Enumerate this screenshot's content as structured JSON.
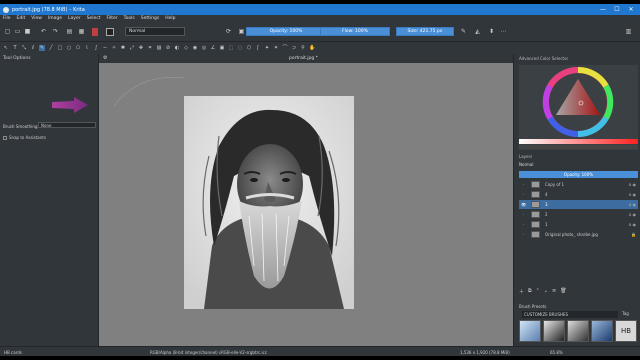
{
  "window": {
    "title": "portrait.jpg (78.8 MiB) – Krita",
    "controls": [
      "—",
      "☐",
      "✕"
    ]
  },
  "menu": [
    "File",
    "Edit",
    "View",
    "Image",
    "Layer",
    "Select",
    "Filter",
    "Tools",
    "Settings",
    "Help"
  ],
  "toolbar": {
    "blending_mode": "Normal",
    "opacity_label": "Opacity: 100%",
    "flow_label": "Flow: 100%",
    "size_label": "Size: 421.75 px"
  },
  "tool_options": {
    "header": "Tool Options",
    "brush_smoothing_label": "Brush Smoothing:",
    "brush_smoothing_value": "None",
    "snap_label": "Snap to Assistants"
  },
  "document": {
    "tab_title": "portrait.jpg *"
  },
  "color_selector": {
    "title": "Advanced Color Selector"
  },
  "layers": {
    "title": "Layers",
    "blend_mode": "Normal",
    "opacity": "Opacity:  100%",
    "items": [
      {
        "name": "Copy of 1",
        "selected": false
      },
      {
        "name": "4",
        "selected": false
      },
      {
        "name": "3",
        "selected": true
      },
      {
        "name": "2",
        "selected": false
      },
      {
        "name": "1",
        "selected": false
      },
      {
        "name": "Original photo_ sharbe.jpg",
        "selected": false
      }
    ]
  },
  "brush_presets": {
    "title": "Brush Presets",
    "tag": "CUSTOMIZE BRUSHES",
    "tag_suffix": "Tag"
  },
  "status": {
    "left": "HB cards",
    "center": "RGB/Alpha (8-bit integer/channel) sRGB-elle-V2-srgbtrc.icc",
    "right": "1,536 x 1,920 (78.8 MiB)",
    "zoom": "65.8%"
  }
}
